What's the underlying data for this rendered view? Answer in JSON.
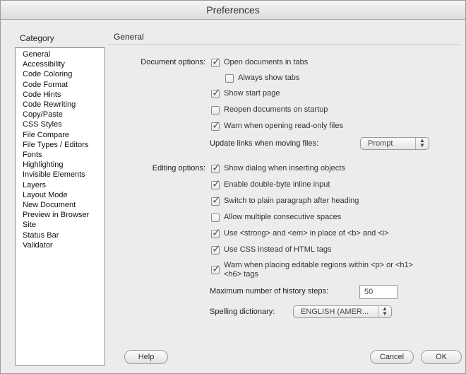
{
  "window": {
    "title": "Preferences"
  },
  "category": {
    "header": "Category",
    "items": [
      "General",
      "Accessibility",
      "Code Coloring",
      "Code Format",
      "Code Hints",
      "Code Rewriting",
      "Copy/Paste",
      "CSS Styles",
      "File Compare",
      "File Types / Editors",
      "Fonts",
      "Highlighting",
      "Invisible Elements",
      "Layers",
      "Layout Mode",
      "New Document",
      "Preview in Browser",
      "Site",
      "Status Bar",
      "Validator"
    ],
    "selected": "General"
  },
  "panel": {
    "title": "General",
    "document_options": {
      "label": "Document options:",
      "items": [
        {
          "label": "Open documents in tabs",
          "checked": true
        },
        {
          "label": "Always show tabs",
          "checked": false
        },
        {
          "label": "Show start page",
          "checked": true
        },
        {
          "label": "Reopen documents on startup",
          "checked": false
        },
        {
          "label": "Warn when opening read-only files",
          "checked": true
        }
      ]
    },
    "update_links": {
      "label": "Update links when moving files:",
      "value": "Prompt"
    },
    "editing_options": {
      "label": "Editing options:",
      "items": [
        {
          "label": "Show dialog when inserting objects",
          "checked": true
        },
        {
          "label": "Enable double-byte inline input",
          "checked": true
        },
        {
          "label": "Switch to plain paragraph after heading",
          "checked": true
        },
        {
          "label": "Allow multiple consecutive spaces",
          "checked": false
        },
        {
          "label": "Use <strong> and <em> in place of <b> and <i>",
          "checked": true
        },
        {
          "label": "Use CSS instead of HTML tags",
          "checked": true
        },
        {
          "label": "Warn when placing editable regions within <p> or <h1>",
          "label2": "<h6> tags",
          "checked": true
        }
      ]
    },
    "history": {
      "label": "Maximum number of history steps:",
      "value": "50"
    },
    "spelling": {
      "label": "Spelling dictionary:",
      "value": "ENGLISH (AMER..."
    }
  },
  "buttons": {
    "help": "Help",
    "cancel": "Cancel",
    "ok": "OK"
  }
}
